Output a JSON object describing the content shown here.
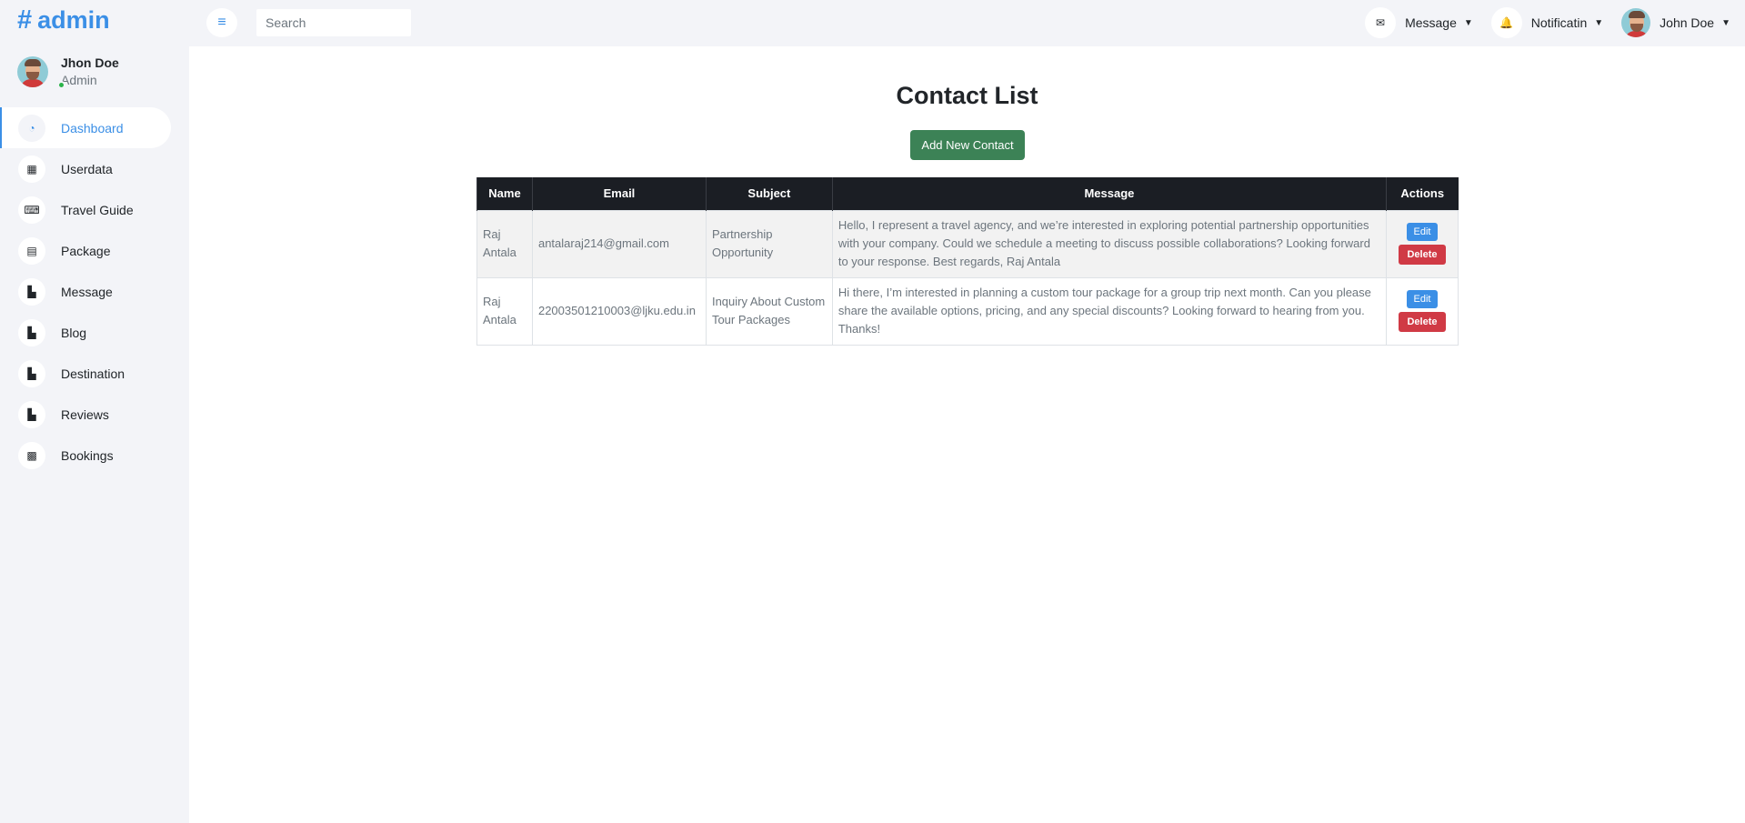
{
  "brand": {
    "hash": "#",
    "text": "admin"
  },
  "profile": {
    "name": "Jhon Doe",
    "role": "Admin"
  },
  "sidebar": {
    "items": [
      {
        "label": "Dashboard",
        "icon": "gauge-icon"
      },
      {
        "label": "Userdata",
        "icon": "grid-icon"
      },
      {
        "label": "Travel Guide",
        "icon": "keyboard-icon"
      },
      {
        "label": "Package",
        "icon": "table-icon"
      },
      {
        "label": "Message",
        "icon": "chart-icon"
      },
      {
        "label": "Blog",
        "icon": "chart-icon"
      },
      {
        "label": "Destination",
        "icon": "chart-icon"
      },
      {
        "label": "Reviews",
        "icon": "chart-icon"
      },
      {
        "label": "Bookings",
        "icon": "calendar-icon"
      }
    ]
  },
  "topbar": {
    "search_placeholder": "Search",
    "message_label": "Message",
    "notification_label": "Notificatin",
    "user_label": "John Doe"
  },
  "main": {
    "title": "Contact List",
    "add_button": "Add New Contact",
    "table": {
      "headers": [
        "Name",
        "Email",
        "Subject",
        "Message",
        "Actions"
      ],
      "rows": [
        {
          "name": "Raj Antala",
          "email": "antalaraj214@gmail.com",
          "subject": "Partnership Opportunity",
          "message": "Hello, I represent a travel agency, and we’re interested in exploring potential partnership opportunities with your company. Could we schedule a meeting to discuss possible collaborations? Looking forward to your response. Best regards, Raj Antala",
          "edit": "Edit",
          "delete": "Delete"
        },
        {
          "name": "Raj Antala",
          "email": "22003501210003@ljku.edu.in",
          "subject": "Inquiry About Custom Tour Packages",
          "message": "Hi there, I’m interested in planning a custom tour package for a group trip next month. Can you please share the available options, pricing, and any special discounts? Looking forward to hearing from you. Thanks!",
          "edit": "Edit",
          "delete": "Delete"
        }
      ]
    }
  },
  "colors": {
    "accent": "#3b8fe6",
    "success": "#3c8256",
    "danger": "#d03a45",
    "table_header": "#1b1e24"
  }
}
